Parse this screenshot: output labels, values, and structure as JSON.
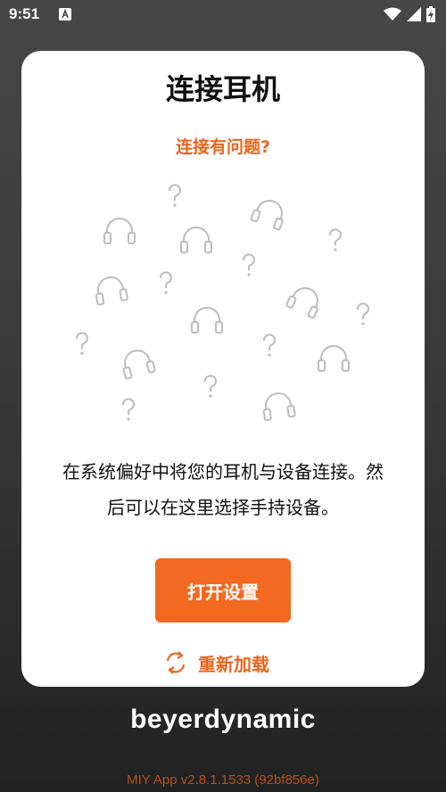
{
  "status_bar": {
    "time": "9:51",
    "icons": [
      "app-notification-icon",
      "wifi-icon",
      "signal-icon",
      "battery-charging-icon"
    ]
  },
  "card": {
    "title": "连接耳机",
    "trouble_link": "连接有问题?",
    "instruction_line1": "在系统偏好中将您的耳机与设备连接。然",
    "instruction_line2": "后可以在这里选择手持设备。",
    "settings_button": "打开设置",
    "reload_label": "重新加载"
  },
  "brand": "beyerdynamic",
  "version": "MIY App v2.8.1.1533 (92bf856e)",
  "colors": {
    "accent": "#f26a21",
    "accent_text": "#e8661d",
    "card_bg": "#ffffff",
    "background": "#3a3a3a"
  }
}
